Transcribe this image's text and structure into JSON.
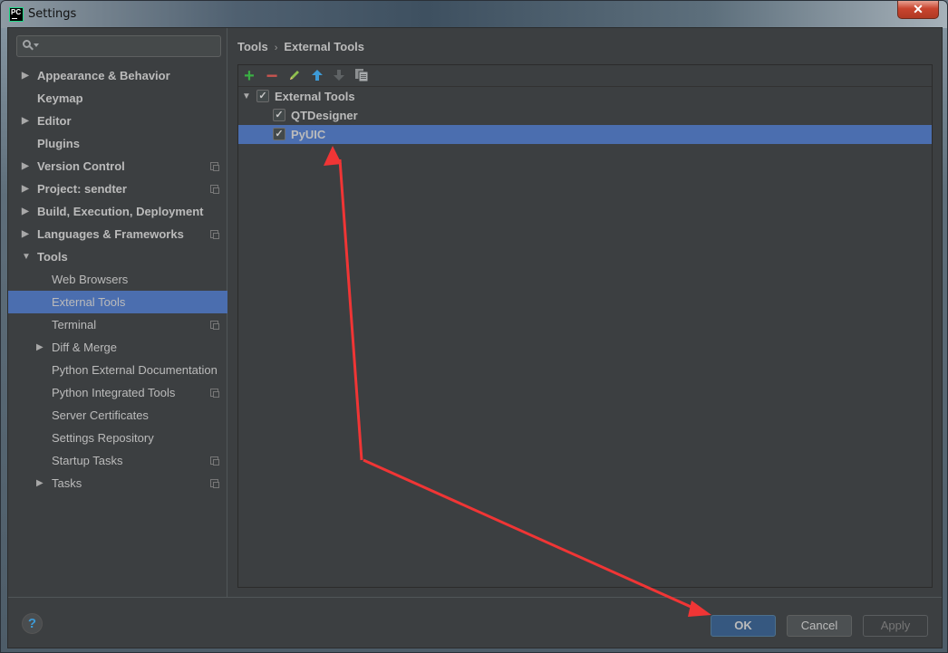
{
  "window": {
    "title": "Settings",
    "app_icon_text": "PC",
    "close_glyph": "✕"
  },
  "search": {
    "placeholder": "",
    "value": ""
  },
  "sidebar": {
    "items": [
      {
        "label": "Appearance & Behavior",
        "level": 0,
        "expandable": true,
        "expanded": false,
        "bold": true,
        "project_icon": false
      },
      {
        "label": "Keymap",
        "level": 0,
        "expandable": false,
        "bold": true,
        "project_icon": false
      },
      {
        "label": "Editor",
        "level": 0,
        "expandable": true,
        "expanded": false,
        "bold": true,
        "project_icon": false
      },
      {
        "label": "Plugins",
        "level": 0,
        "expandable": false,
        "bold": true,
        "project_icon": false
      },
      {
        "label": "Version Control",
        "level": 0,
        "expandable": true,
        "expanded": false,
        "bold": true,
        "project_icon": true
      },
      {
        "label": "Project: sendter",
        "level": 0,
        "expandable": true,
        "expanded": false,
        "bold": true,
        "project_icon": true
      },
      {
        "label": "Build, Execution, Deployment",
        "level": 0,
        "expandable": true,
        "expanded": false,
        "bold": true,
        "project_icon": false
      },
      {
        "label": "Languages & Frameworks",
        "level": 0,
        "expandable": true,
        "expanded": false,
        "bold": true,
        "project_icon": true
      },
      {
        "label": "Tools",
        "level": 0,
        "expandable": true,
        "expanded": true,
        "bold": true,
        "project_icon": false
      },
      {
        "label": "Web Browsers",
        "level": 1,
        "expandable": false,
        "project_icon": false
      },
      {
        "label": "External Tools",
        "level": 1,
        "expandable": false,
        "project_icon": false,
        "selected": true
      },
      {
        "label": "Terminal",
        "level": 1,
        "expandable": false,
        "project_icon": true
      },
      {
        "label": "Diff & Merge",
        "level": 1,
        "expandable": true,
        "expanded": false,
        "project_icon": false
      },
      {
        "label": "Python External Documentation",
        "level": 1,
        "expandable": false,
        "project_icon": false
      },
      {
        "label": "Python Integrated Tools",
        "level": 1,
        "expandable": false,
        "project_icon": true
      },
      {
        "label": "Server Certificates",
        "level": 1,
        "expandable": false,
        "project_icon": false
      },
      {
        "label": "Settings Repository",
        "level": 1,
        "expandable": false,
        "project_icon": false
      },
      {
        "label": "Startup Tasks",
        "level": 1,
        "expandable": false,
        "project_icon": true
      },
      {
        "label": "Tasks",
        "level": 1,
        "expandable": true,
        "expanded": false,
        "project_icon": true
      }
    ]
  },
  "breadcrumb": {
    "parent": "Tools",
    "separator": "›",
    "current": "External Tools"
  },
  "toolbar": {
    "add": "+",
    "remove": "−",
    "up": "🡅",
    "down": "🡇"
  },
  "tree": {
    "root": {
      "label": "External Tools",
      "checked": true,
      "expanded": true
    },
    "children": [
      {
        "label": "QTDesigner",
        "checked": true,
        "selected": false
      },
      {
        "label": "PyUIC",
        "checked": true,
        "selected": true
      }
    ]
  },
  "buttons": {
    "help": "?",
    "ok": "OK",
    "cancel": "Cancel",
    "apply": "Apply"
  },
  "colors": {
    "selection": "#4b6eaf",
    "background": "#3c3f41",
    "annotation_arrow": "#f03535",
    "ok_button": "#365880"
  },
  "annotation": {
    "description": "Red arrows drawn from OK button to PyUIC row"
  }
}
